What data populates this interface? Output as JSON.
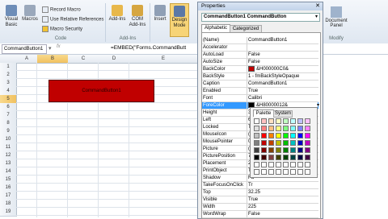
{
  "ribbon": {
    "visual_basic": "Visual Basic",
    "macros": "Macros",
    "record_macro": "Record Macro",
    "use_relative": "Use Relative References",
    "macro_security": "Macro Security",
    "code_group": "Code",
    "addins": "Add-Ins",
    "com_addins": "COM Add-Ins",
    "addins_group": "Add-Ins",
    "insert": "Insert",
    "design_mode": "Design Mode",
    "document_panel": "Document Panel",
    "modify_group": "Modify"
  },
  "formula_bar": {
    "name_box": "CommandButton1",
    "formula": "=EMBED(\"Forms.CommandButt"
  },
  "sheet": {
    "columns": [
      "A",
      "B",
      "C",
      "D",
      "E"
    ],
    "rows": [
      "1",
      "2",
      "3",
      "4",
      "5",
      "6",
      "7",
      "8",
      "9",
      "10",
      "11",
      "12",
      "13",
      "14",
      "15",
      "16",
      "17",
      "18",
      "19"
    ],
    "button_label": "CommandButton1"
  },
  "properties": {
    "title": "Properties",
    "object": "CommandButton1 CommandButton",
    "tabs": [
      "Alphabetic",
      "Categorized"
    ],
    "rows": [
      {
        "name": "(Name)",
        "value": "CommandButton1"
      },
      {
        "name": "Accelerator",
        "value": ""
      },
      {
        "name": "AutoLoad",
        "value": "False"
      },
      {
        "name": "AutoSize",
        "value": "False"
      },
      {
        "name": "BackColor",
        "value": "&H000000C0&"
      },
      {
        "name": "BackStyle",
        "value": "1 - fmBackStyleOpaque"
      },
      {
        "name": "Caption",
        "value": "CommandButton1"
      },
      {
        "name": "Enabled",
        "value": "True"
      },
      {
        "name": "Font",
        "value": "Calibri"
      },
      {
        "name": "ForeColor",
        "value": "&H80000012&"
      },
      {
        "name": "Height",
        "value": "36"
      },
      {
        "name": "Left",
        "value": "61"
      },
      {
        "name": "Locked",
        "value": "Tr"
      },
      {
        "name": "MouseIcon",
        "value": "(N"
      },
      {
        "name": "MousePointer",
        "value": "0"
      },
      {
        "name": "Picture",
        "value": "(N"
      },
      {
        "name": "PicturePosition",
        "value": "7"
      },
      {
        "name": "Placement",
        "value": "2"
      },
      {
        "name": "PrintObject",
        "value": "Tr"
      },
      {
        "name": "Shadow",
        "value": "Fa"
      },
      {
        "name": "TakeFocusOnClick",
        "value": "Tr"
      },
      {
        "name": "Top",
        "value": "32.25"
      },
      {
        "name": "Visible",
        "value": "True"
      },
      {
        "name": "Width",
        "value": "225"
      },
      {
        "name": "WordWrap",
        "value": "False"
      }
    ],
    "palette_tabs": [
      "Palette",
      "System"
    ],
    "palette_colors": [
      "#ffffff",
      "#ffc0c0",
      "#ffe0c0",
      "#ffffc0",
      "#c0ffc0",
      "#c0ffff",
      "#c0c0ff",
      "#ffc0ff",
      "#e0e0e0",
      "#ff8080",
      "#ffc080",
      "#ffff80",
      "#80ff80",
      "#80ffff",
      "#8080ff",
      "#ff80ff",
      "#c0c0c0",
      "#ff0000",
      "#ff8000",
      "#ffff00",
      "#00ff00",
      "#00ffff",
      "#0000ff",
      "#ff00ff",
      "#808080",
      "#c00000",
      "#c04000",
      "#c0c000",
      "#00c000",
      "#00c0c0",
      "#0000c0",
      "#c000c0",
      "#404040",
      "#800000",
      "#804000",
      "#808000",
      "#008000",
      "#008080",
      "#000080",
      "#800080",
      "#000000",
      "#400000",
      "#804040",
      "#404000",
      "#004000",
      "#004040",
      "#000040",
      "#400040",
      "#ffffff",
      "#ffffff",
      "#ffffff",
      "#ffffff",
      "#ffffff",
      "#ffffff",
      "#ffffff",
      "#ffffff",
      "#ffffff",
      "#ffffff",
      "#ffffff",
      "#ffffff",
      "#ffffff",
      "#ffffff",
      "#ffffff",
      "#ffffff"
    ],
    "backcolor_swatch": "#c00000",
    "forecolor_swatch": "#000000"
  },
  "colors": {
    "button_fill": "#c00000",
    "selection": "#3399ff"
  }
}
